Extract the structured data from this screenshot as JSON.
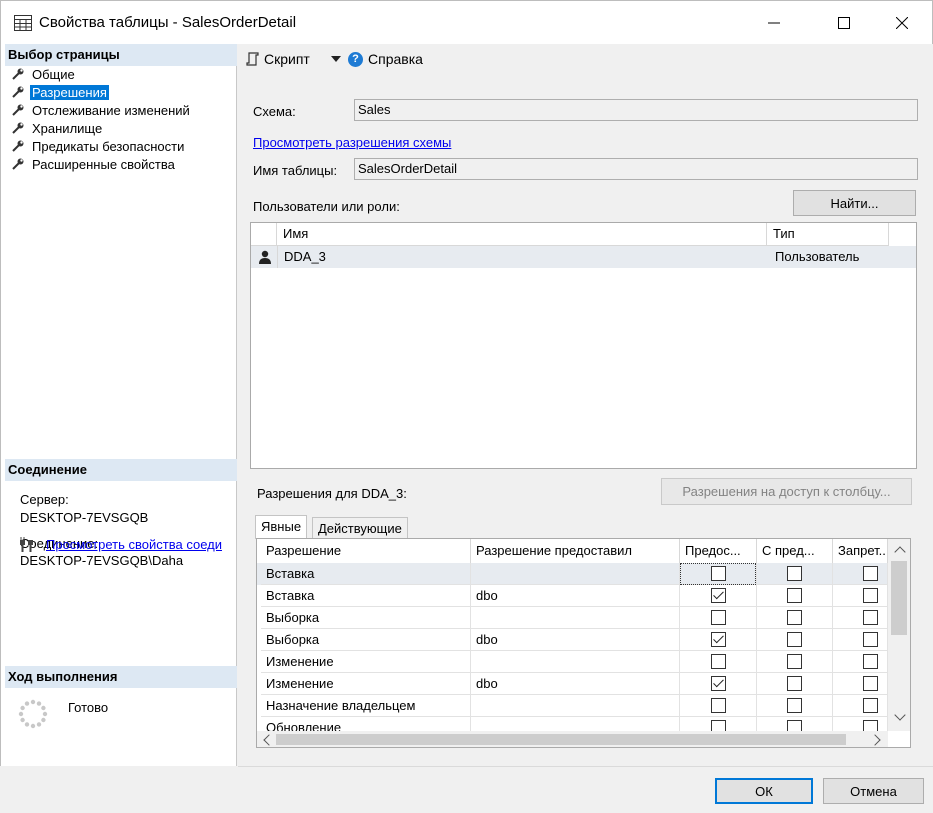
{
  "window": {
    "title": "Свойства таблицы - SalesOrderDetail"
  },
  "left_panel": {
    "select_page_header": "Выбор страницы",
    "pages": [
      {
        "label": "Общие"
      },
      {
        "label": "Разрешения"
      },
      {
        "label": "Отслеживание изменений"
      },
      {
        "label": "Хранилище"
      },
      {
        "label": "Предикаты безопасности"
      },
      {
        "label": "Расширенные свойства"
      }
    ],
    "selected_page_index": 1,
    "connection_header": "Соединение",
    "server_label": "Сервер:",
    "server_value": "DESKTOP-7EVSGQB",
    "connection_label": "Соединение:",
    "connection_value": "DESKTOP-7EVSGQB\\Daha",
    "connection_link": "Просмотреть свойства соеди",
    "progress_header": "Ход выполнения",
    "progress_status": "Готово"
  },
  "toolbar": {
    "script_label": "Скрипт",
    "help_label": "Справка",
    "help_icon": "?"
  },
  "main": {
    "schema_label": "Схема:",
    "schema_value": "Sales",
    "view_schema_permissions_link": "Просмотреть разрешения схемы",
    "table_name_label": "Имя таблицы:",
    "table_name_value": "SalesOrderDetail",
    "users_roles_label": "Пользователи или роли:",
    "find_button": "Найти...",
    "users_grid": {
      "columns": [
        "Имя",
        "Тип"
      ],
      "rows": [
        {
          "name": "DDA_3",
          "type": "Пользователь"
        }
      ]
    },
    "permissions_for_label": "Разрешения для DDA_3:",
    "column_permissions_button": "Разрешения на доступ к столбцу...",
    "tabs": [
      {
        "label": "Явные"
      },
      {
        "label": "Действующие"
      }
    ],
    "permissions_grid": {
      "columns": [
        "Разрешение",
        "Разрешение предоставил",
        "Предос...",
        "С пред...",
        "Запрет..."
      ],
      "rows": [
        {
          "permission": "Вставка",
          "grantor": "",
          "grant": false,
          "with_grant": false,
          "deny": false
        },
        {
          "permission": "Вставка",
          "grantor": "dbo",
          "grant": true,
          "with_grant": false,
          "deny": false
        },
        {
          "permission": "Выборка",
          "grantor": "",
          "grant": false,
          "with_grant": false,
          "deny": false
        },
        {
          "permission": "Выборка",
          "grantor": "dbo",
          "grant": true,
          "with_grant": false,
          "deny": false
        },
        {
          "permission": "Изменение",
          "grantor": "",
          "grant": false,
          "with_grant": false,
          "deny": false
        },
        {
          "permission": "Изменение",
          "grantor": "dbo",
          "grant": true,
          "with_grant": false,
          "deny": false
        },
        {
          "permission": "Назначение владельцем",
          "grantor": "",
          "grant": false,
          "with_grant": false,
          "deny": false
        },
        {
          "permission": "Обновление",
          "grantor": "",
          "grant": false,
          "with_grant": false,
          "deny": false
        }
      ]
    }
  },
  "footer": {
    "ok_button": "ОК",
    "cancel_button": "Отмена"
  },
  "colors": {
    "selection": "#0078d7",
    "header_band": "#dde8f3",
    "row_highlight": "#e7ebf0",
    "link": "#0000ee"
  }
}
